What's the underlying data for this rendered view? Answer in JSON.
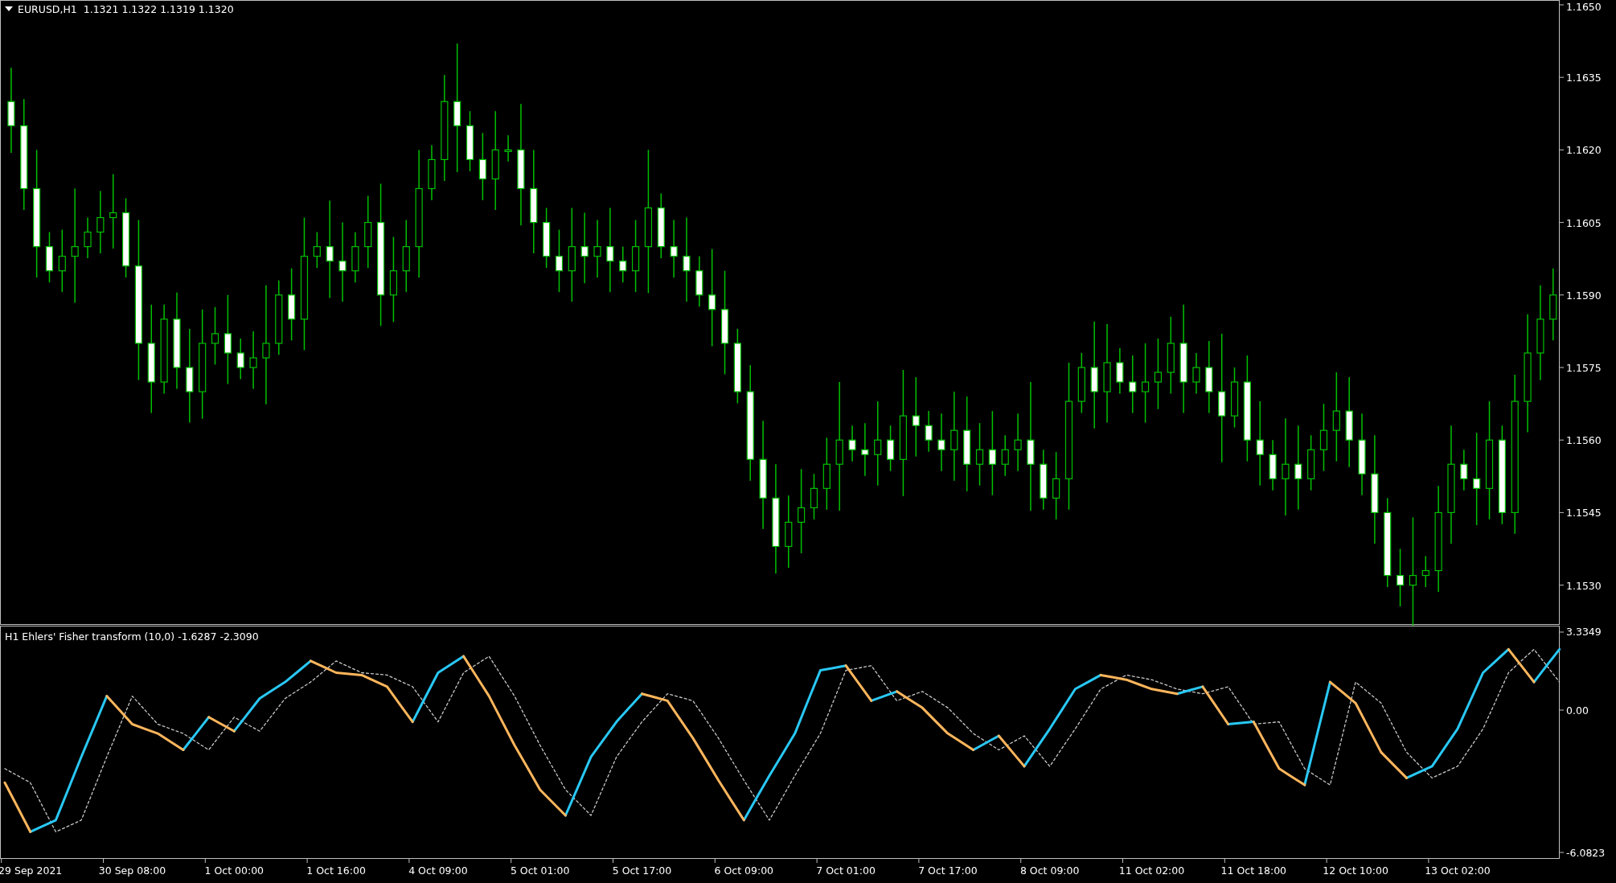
{
  "main_chart": {
    "header": "EURUSD,H1  1.1321 1.1322 1.1319 1.1320",
    "price_axis": [
      "1.1650",
      "1.1635",
      "1.1620",
      "1.1605",
      "1.1590",
      "1.1575",
      "1.1560",
      "1.1545",
      "1.1530"
    ]
  },
  "indicator": {
    "header": "H1 Ehlers' Fisher transform (10,0) -1.6287 -2.3090",
    "chart_data": {
      "type": "line",
      "ylim": [
        -6.3572,
        3.6098
      ],
      "yticks": [
        {
          "value": 3.3349,
          "label": "3.3349"
        },
        {
          "value": 0,
          "label": "0.00"
        },
        {
          "value": -6.0823,
          "label": "-6.0823"
        }
      ],
      "categories": [
        null,
        null,
        "29 Sep 2021",
        null,
        null,
        null,
        null,
        null,
        null,
        null,
        "30 Sep 08:00",
        null,
        null,
        null,
        null,
        null,
        null,
        null,
        "1 Oct 00:00",
        null,
        null,
        null,
        null,
        null,
        null,
        null,
        "1 Oct 16:00",
        null,
        null,
        null,
        null,
        null,
        null,
        null,
        "4 Oct 09:00",
        null,
        null,
        null,
        null,
        null,
        null,
        null,
        "5 Oct 01:00",
        null,
        null,
        null,
        null,
        null,
        null,
        null,
        "5 Oct 17:00",
        null,
        null,
        null,
        null,
        null,
        null,
        null,
        "6 Oct 09:00",
        null,
        null,
        null,
        null,
        null,
        null,
        null,
        "7 Oct 01:00",
        null,
        null,
        null,
        null,
        null,
        null,
        null,
        "7 Oct 17:00",
        null,
        null,
        null,
        null,
        null,
        null,
        null,
        "8 Oct 09:00",
        null,
        null,
        null,
        null,
        null,
        null,
        null,
        "11 Oct 02:00",
        null,
        null,
        null,
        null,
        null,
        null,
        null,
        "11 Oct 18:00",
        null,
        null,
        null,
        null,
        null,
        null,
        null,
        "12 Oct 10:00",
        null,
        null,
        null,
        null,
        null,
        null,
        null,
        "13 Oct 02:00",
        null,
        null,
        null,
        null,
        null,
        null,
        null,
        null
      ],
      "series": [
        {
          "color": "#c8c8c8",
          "line_style": "dashed",
          "values": [
            -2.5,
            -2.8,
            -3.1,
            -4.15,
            -5.2,
            -4.95,
            -4.7,
            -3.35,
            -2.0,
            -0.7,
            0.6,
            0.0,
            -0.6,
            -0.8,
            -1.0,
            -1.35,
            -1.7,
            -1.0,
            -0.3,
            -0.6,
            -0.9,
            -0.2,
            0.5,
            0.85,
            1.2,
            1.65,
            2.1,
            1.85,
            1.6,
            1.55,
            1.5,
            1.25,
            1.0,
            0.25,
            -0.5,
            0.55,
            1.6,
            1.95,
            2.3,
            1.45,
            0.6,
            -0.45,
            -1.5,
            -2.45,
            -3.4,
            -3.95,
            -4.5,
            -3.25,
            -2.0,
            -1.25,
            -0.5,
            0.1,
            0.7,
            0.55,
            0.4,
            -0.4,
            -1.2,
            -2.1,
            -3.0,
            -3.85,
            -4.7,
            -3.75,
            -2.8,
            -1.9,
            -1.0,
            0.35,
            1.7,
            1.8,
            1.9,
            1.15,
            0.4,
            0.6,
            0.8,
            0.45,
            0.1,
            -0.45,
            -1.0,
            -1.35,
            -1.7,
            -1.4,
            -1.1,
            -1.75,
            -2.4,
            -1.6,
            -0.8,
            0.05,
            0.9,
            1.2,
            1.5,
            1.4,
            1.3,
            1.1,
            0.9,
            0.8,
            0.7,
            0.85,
            1.0,
            0.2,
            -0.6,
            -0.55,
            -0.5,
            -1.5,
            -2.5,
            -2.85,
            -3.2,
            -1.0,
            1.2,
            0.75,
            0.3,
            -0.75,
            -1.8,
            -2.35,
            -2.9,
            -2.65,
            -2.4,
            -1.6,
            -0.8,
            0.4,
            1.6,
            2.1,
            2.6,
            1.9,
            1.2
          ]
        },
        {
          "color": "#29c8f5",
          "values": [
            null,
            null,
            -5.2,
            -4.95,
            -4.7,
            -3.35,
            -2.0,
            -0.7,
            0.6,
            null,
            null,
            null,
            null,
            null,
            -1.7,
            -1.0,
            -0.3,
            null,
            -0.9,
            -0.2,
            0.5,
            0.85,
            1.2,
            1.65,
            2.1,
            null,
            null,
            null,
            null,
            null,
            null,
            null,
            -0.5,
            0.55,
            1.6,
            1.95,
            2.3,
            null,
            null,
            null,
            null,
            null,
            null,
            null,
            -4.5,
            -3.25,
            -2.0,
            -1.25,
            -0.5,
            0.1,
            0.7,
            null,
            null,
            null,
            null,
            null,
            null,
            null,
            -4.7,
            -3.75,
            -2.8,
            -1.9,
            -1.0,
            0.35,
            1.7,
            1.8,
            1.9,
            null,
            0.4,
            0.6,
            0.8,
            null,
            null,
            null,
            null,
            null,
            -1.7,
            -1.4,
            -1.1,
            null,
            -2.4,
            -1.6,
            -0.8,
            0.05,
            0.9,
            1.2,
            1.5,
            null,
            null,
            null,
            null,
            null,
            0.7,
            0.85,
            1.0,
            null,
            -0.6,
            -0.55,
            -0.5,
            null,
            null,
            null,
            -3.2,
            -1.0,
            1.2,
            null,
            null,
            null,
            null,
            null,
            -2.9,
            -2.65,
            -2.4,
            -1.6,
            -0.8,
            0.4,
            1.6,
            2.1,
            2.6,
            null,
            1.2,
            1.9,
            2.6
          ]
        },
        {
          "color": "#ffb65c",
          "values": [
            -3.1,
            -4.15,
            -5.2,
            null,
            null,
            null,
            null,
            null,
            0.6,
            0.0,
            -0.6,
            -0.8,
            -1.0,
            -1.35,
            -1.7,
            null,
            -0.3,
            -0.6,
            -0.9,
            null,
            null,
            null,
            null,
            null,
            2.1,
            1.85,
            1.6,
            1.55,
            1.5,
            1.25,
            1.0,
            0.25,
            -0.5,
            null,
            null,
            null,
            2.3,
            1.45,
            0.6,
            -0.45,
            -1.5,
            -2.45,
            -3.4,
            -3.95,
            -4.5,
            null,
            null,
            null,
            null,
            null,
            0.7,
            0.55,
            0.4,
            -0.4,
            -1.2,
            -2.1,
            -3.0,
            -3.85,
            -4.7,
            null,
            null,
            null,
            null,
            null,
            null,
            null,
            1.9,
            1.15,
            0.4,
            null,
            0.8,
            0.45,
            0.1,
            -0.45,
            -1.0,
            -1.35,
            -1.7,
            null,
            -1.1,
            -1.75,
            -2.4,
            null,
            null,
            null,
            null,
            null,
            1.5,
            1.4,
            1.3,
            1.1,
            0.9,
            0.8,
            0.7,
            null,
            1.0,
            0.2,
            -0.6,
            null,
            -0.5,
            -1.5,
            -2.5,
            -2.85,
            -3.2,
            null,
            1.2,
            0.75,
            0.3,
            -0.75,
            -1.8,
            -2.35,
            -2.9,
            null,
            null,
            null,
            null,
            null,
            null,
            null,
            2.6,
            1.9,
            1.2,
            null,
            null
          ]
        }
      ]
    }
  }
}
